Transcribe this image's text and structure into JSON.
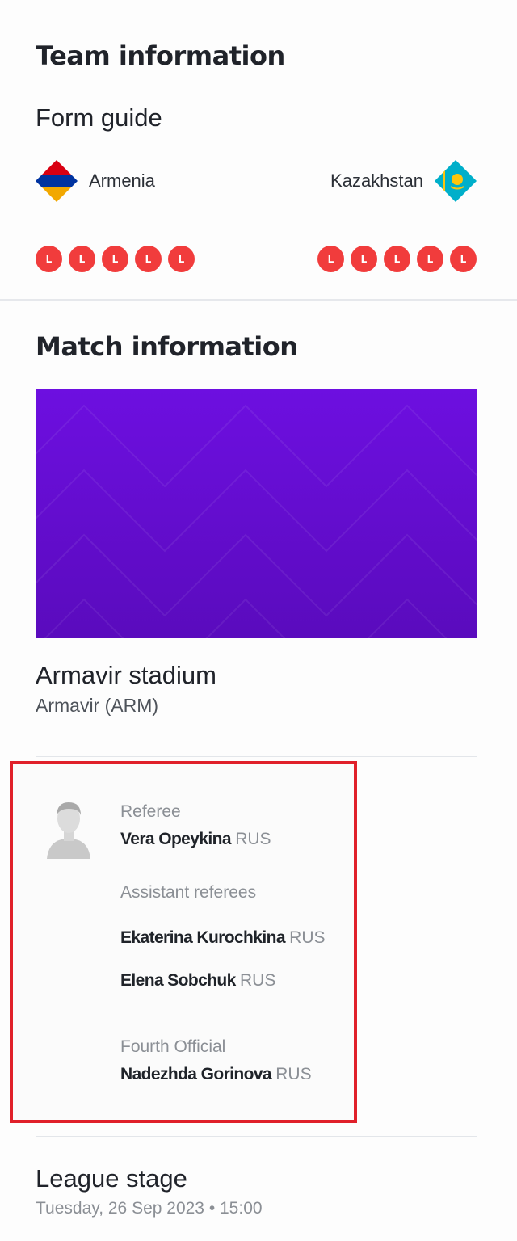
{
  "team_information": {
    "title": "Team information",
    "form_guide_title": "Form guide",
    "home": {
      "name": "Armenia",
      "flag_icon": "armenia-flag-icon",
      "form": [
        "L",
        "L",
        "L",
        "L",
        "L"
      ]
    },
    "away": {
      "name": "Kazakhstan",
      "flag_icon": "kazakhstan-flag-icon",
      "form": [
        "L",
        "L",
        "L",
        "L",
        "L"
      ]
    },
    "loss_color": "#f13c3c"
  },
  "match_information": {
    "title": "Match information",
    "banner_color": "#6a0fdc",
    "stadium": "Armavir stadium",
    "city": "Armavir (ARM)"
  },
  "officials": {
    "referee_label": "Referee",
    "referee": {
      "name": "Vera Opeykina",
      "nat": "RUS"
    },
    "assistants_label": "Assistant referees",
    "assistants": [
      {
        "name": "Ekaterina Kurochkina",
        "nat": "RUS"
      },
      {
        "name": "Elena Sobchuk",
        "nat": "RUS"
      }
    ],
    "fourth_label": "Fourth Official",
    "fourth": {
      "name": "Nadezhda Gorinova",
      "nat": "RUS"
    },
    "highlight_color": "#e0202a"
  },
  "league_stage": {
    "title": "League stage",
    "date": "Tuesday, 26 Sep 2023 • 15:00"
  }
}
